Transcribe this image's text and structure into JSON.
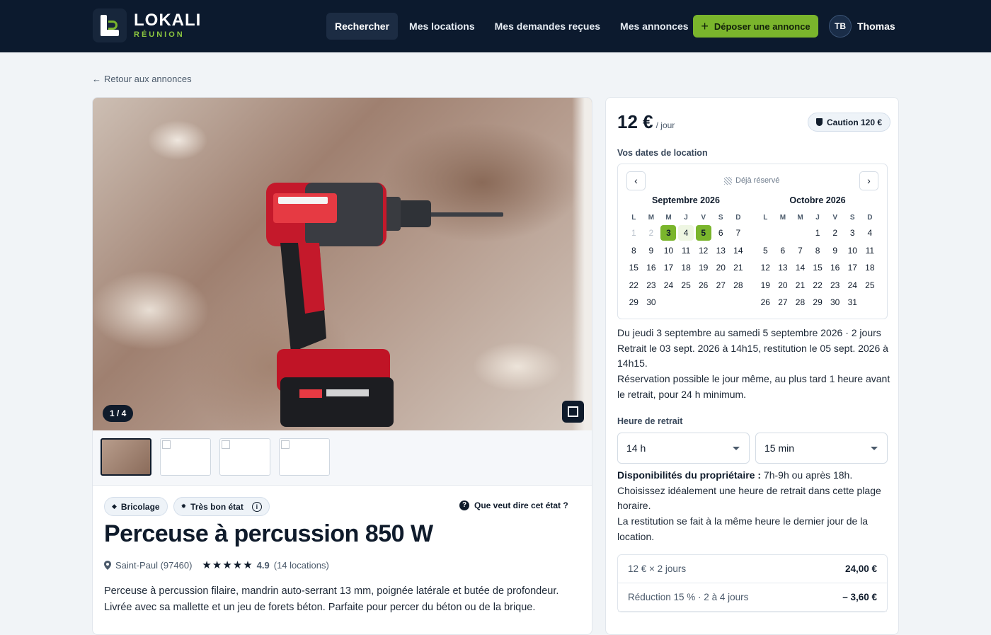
{
  "brand": {
    "name": "LOKALI",
    "sub": "RÉUNION"
  },
  "nav": {
    "items": [
      "Rechercher",
      "Mes locations",
      "Mes demandes reçues",
      "Mes annonces"
    ],
    "active_index": 0,
    "deposit_label": "Déposer une annonce",
    "user_initials": "TB",
    "user_name": "Thomas"
  },
  "back_link": "Retour aux annonces",
  "gallery": {
    "counter": "1 / 4",
    "thumb_count": 4,
    "selected": 0
  },
  "listing": {
    "tags": [
      {
        "label": "Bricolage",
        "icon": "tag-icon"
      },
      {
        "label": "Très bon état",
        "icon": "badge-icon"
      }
    ],
    "state_help": "Que veut dire cet état ?",
    "title": "Perceuse à percussion 850 W",
    "location": "Saint-Paul (97460)",
    "rating": "4.9",
    "rating_stars": 5,
    "reviews": "(14 locations)",
    "description": "Perceuse à percussion filaire, mandrin auto-serrant 13 mm, poignée latérale et butée de profondeur. Livrée avec sa mallette et un jeu de forets béton. Parfaite pour percer du béton ou de la brique."
  },
  "booking": {
    "price": "12 €",
    "price_unit": "/ jour",
    "deposit": "Caution 120 €",
    "dates_label": "Vos dates de location",
    "legend": "Déjà réservé",
    "weekdays": [
      "L",
      "M",
      "M",
      "J",
      "V",
      "S",
      "D"
    ],
    "months": [
      {
        "title": "Septembre 2026",
        "offset": 0,
        "days": 30,
        "past": [
          1,
          2
        ],
        "range": [
          3,
          5
        ]
      },
      {
        "title": "Octobre 2026",
        "offset": 3,
        "days": 31,
        "past": [],
        "range": []
      }
    ],
    "summary": [
      "Du jeudi 3 septembre au samedi 5 septembre 2026 · 2 jours",
      "Retrait le 03 sept. 2026 à 14h15, restitution le 05 sept. 2026 à 14h15.",
      "Réservation possible le jour même, au plus tard 1 heure avant le retrait, pour 24 h minimum."
    ],
    "pickup_label": "Heure de retrait",
    "pickup_hour": "14 h",
    "pickup_minute": "15 min",
    "owner_avail_label": "Disponibilités du propriétaire :",
    "owner_avail_value": " 7h-9h ou après 18h.",
    "advice": "Choisissez idéalement une heure de retrait dans cette plage horaire.",
    "return_note": "La restitution se fait à la même heure le dernier jour de la location.",
    "price_lines": [
      {
        "label": "12 € × 2 jours",
        "value": "24,00 €"
      },
      {
        "label": "Réduction 15 % · 2 à 4 jours",
        "value": "– 3,60 €"
      }
    ]
  }
}
